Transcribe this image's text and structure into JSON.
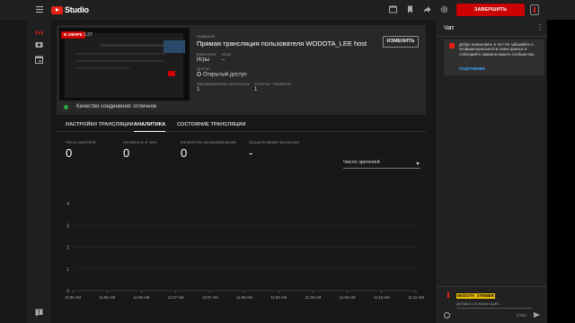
{
  "header": {
    "logo_text": "Studio",
    "end_button": "ЗАВЕРШИТЬ ТРАНСЛЯЦИЮ"
  },
  "preview": {
    "live_badge": "В ЭФИРЕ",
    "live_time": "1:27",
    "connection": "Качество соединения: отличное"
  },
  "stream": {
    "title_label": "Название",
    "title": "Прямая трансляция пользователя WODOTA_LEE host",
    "edit_button": "ИЗМЕНИТЬ",
    "category_label": "Категория",
    "category_value": "Игры",
    "game_label": "Игра",
    "game_value": "–",
    "access_label": "Доступ",
    "access_value": "Открытый доступ",
    "concurrent_label": "Одновременные просмотры",
    "concurrent_value": "1",
    "likes_label": "Отметки \"Нравится\"",
    "likes_value": "1"
  },
  "tabs": [
    {
      "label": "НАСТРОЙКИ ТРАНСЛЯЦИИ"
    },
    {
      "label": "АНАЛИТИКА"
    },
    {
      "label": "СОСТОЯНИЕ ТРАНСЛЯЦИИ"
    }
  ],
  "metrics": [
    {
      "label": "Число зрителей",
      "value": "0"
    },
    {
      "label": "Активность в чате",
      "value": "0"
    },
    {
      "label": "Количество воспроизведений",
      "value": "0"
    },
    {
      "label": "Средняя время просмотра",
      "value": "-"
    }
  ],
  "metric_select": {
    "value": "Число зрителей"
  },
  "chart_data": {
    "type": "line",
    "x": [
      "11:05 AM",
      "11:06 AM",
      "11:06 AM",
      "11:07 AM",
      "11:07 AM",
      "11:08 AM",
      "11:08 AM",
      "11:09 AM",
      "11:09 AM",
      "11:10 AM",
      "11:10 AM"
    ],
    "series": [
      {
        "values": [
          0,
          0,
          0,
          0,
          0,
          0,
          0,
          0,
          0,
          0,
          0
        ]
      }
    ],
    "y_ticks": [
      "0",
      "1",
      "2",
      "3",
      "4"
    ],
    "ylim": [
      0,
      4
    ],
    "grid": true
  },
  "chat": {
    "title": "Чат",
    "notice_text": "Добро пожаловать в чат! Не забывайте о конфиденциальности своих данных и соблюдайте правила нашего сообщества.",
    "notice_link": "ПОДРОБНЕЕ",
    "username": "WODOTA_STRIMER",
    "input_placeholder": "Добавить комментарий...",
    "char_count": "0/200"
  },
  "colors": {
    "accent_red": "#cc0000",
    "connection_ok": "#2ba640",
    "link_blue": "#3ea6ff",
    "username_badge": "#f0c000"
  }
}
